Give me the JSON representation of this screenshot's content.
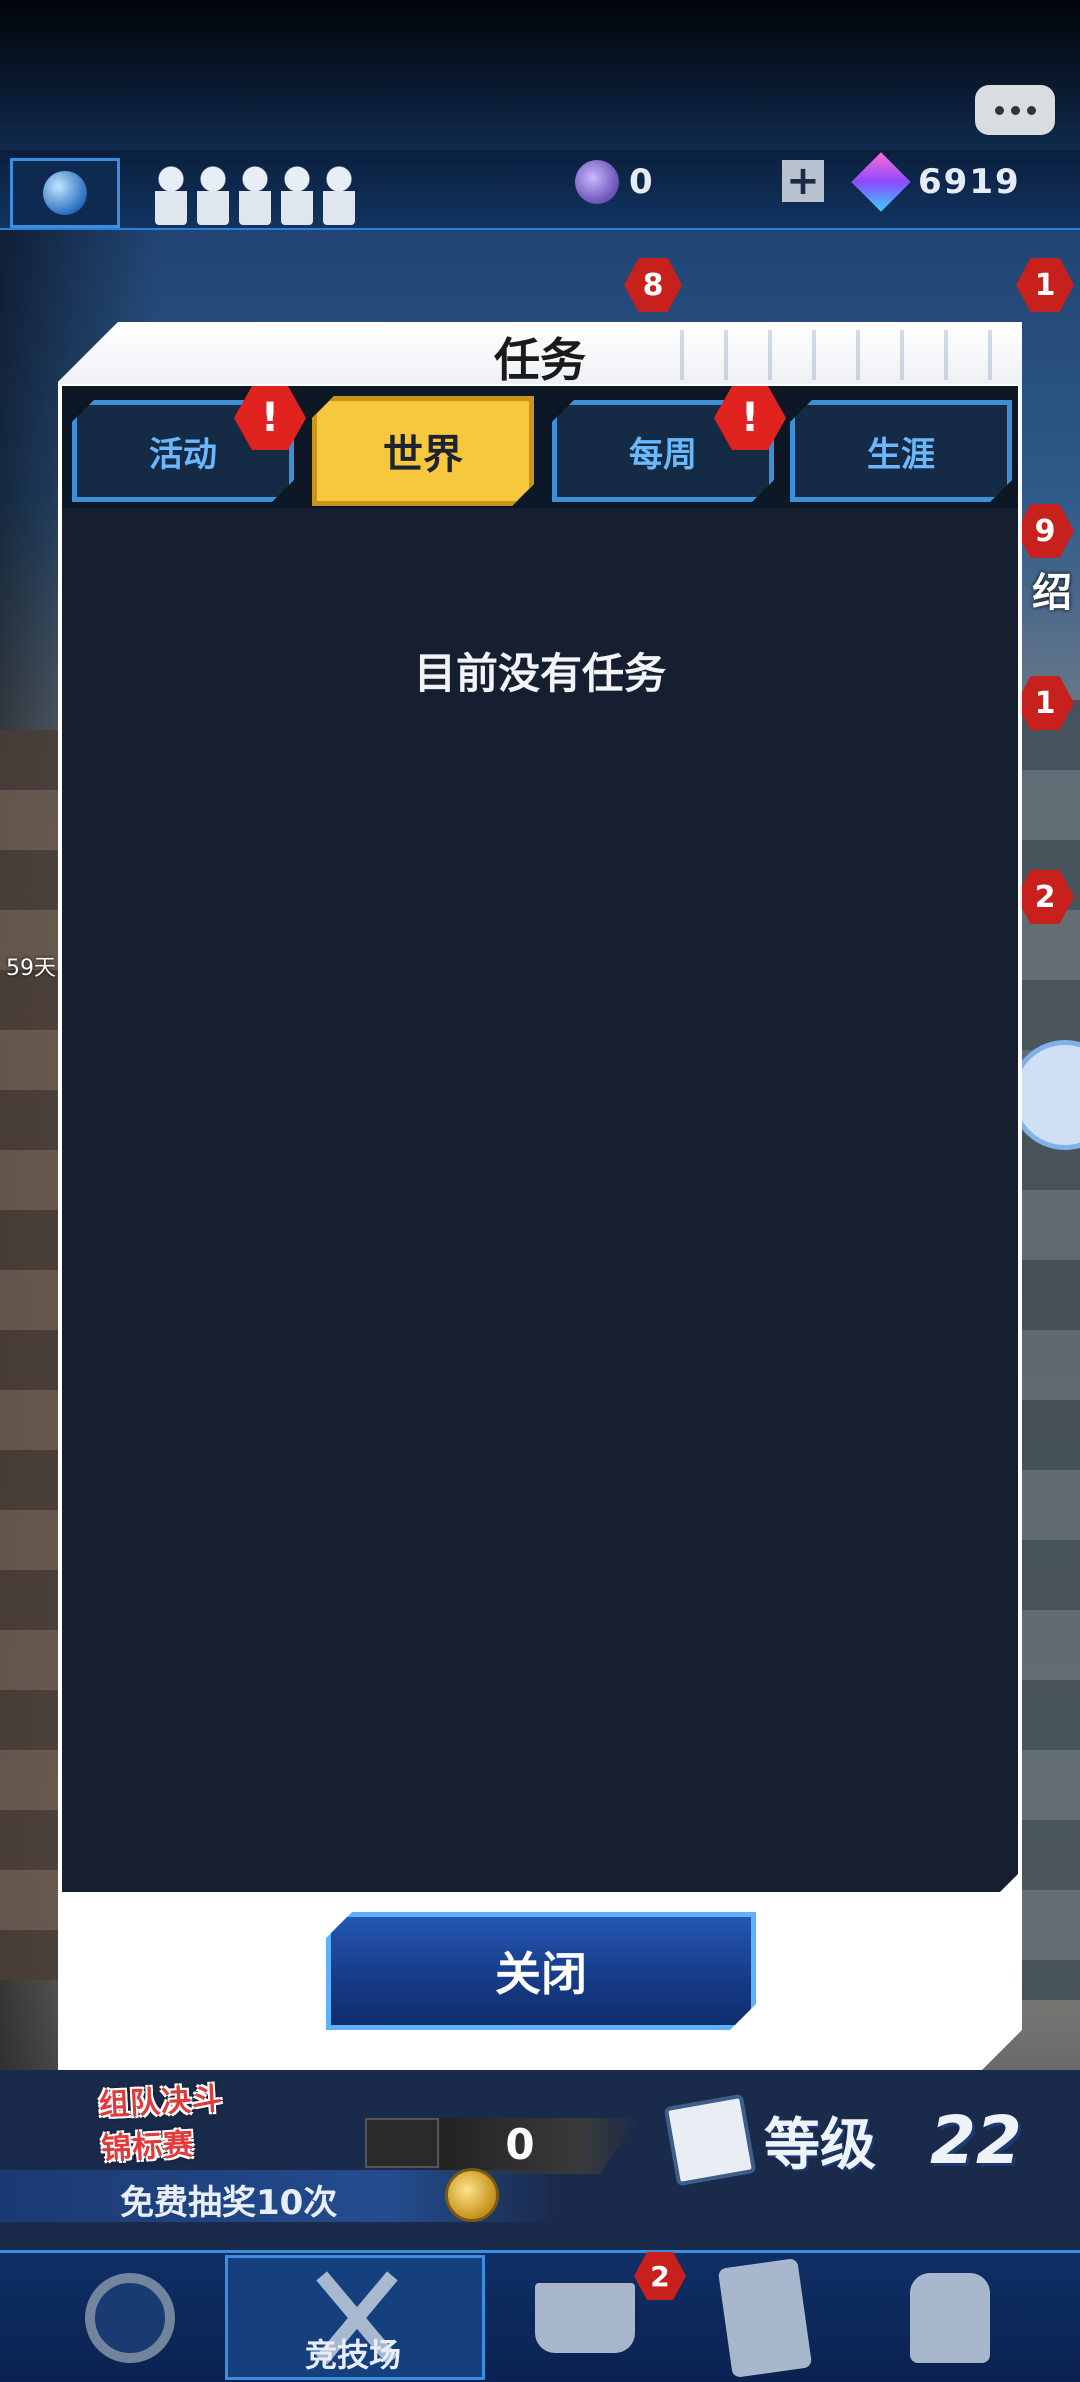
{
  "hud": {
    "currency_a_value": "0",
    "currency_b_value": "6919",
    "badges": [
      "8",
      "1",
      "9",
      "1",
      "2"
    ],
    "side_label": "绍",
    "days_label": "59天"
  },
  "modal": {
    "title": "任务",
    "tabs": [
      {
        "label": "活动",
        "alert": "!"
      },
      {
        "label": "世界",
        "active": true
      },
      {
        "label": "每周",
        "alert": "!"
      },
      {
        "label": "生涯"
      }
    ],
    "empty_message": "目前没有任务",
    "close_label": "关闭"
  },
  "bottom": {
    "event_banner": "组队决斗 锦标赛",
    "mail_count": "0",
    "free_draw": "免费抽奖10次",
    "level_label": "等级",
    "level_value": "22",
    "nav_arena_label": "竞技场",
    "nav_badge": "2"
  },
  "colors": {
    "active_tab": "#f7c73d",
    "inactive_tab_text": "#6ab8ff",
    "alert_red": "#e1231f",
    "panel_dark": "#151f2f",
    "close_button": "#163a86"
  },
  "icons": [
    "chat-icon",
    "globe-icon",
    "player-slot-icon",
    "coin-icon",
    "gem-icon",
    "plus-icon",
    "crown-icon",
    "deck-icon",
    "profile-gear-icon",
    "arena-swords-icon",
    "shop-cart-icon",
    "cards-icon",
    "lock-icon"
  ]
}
